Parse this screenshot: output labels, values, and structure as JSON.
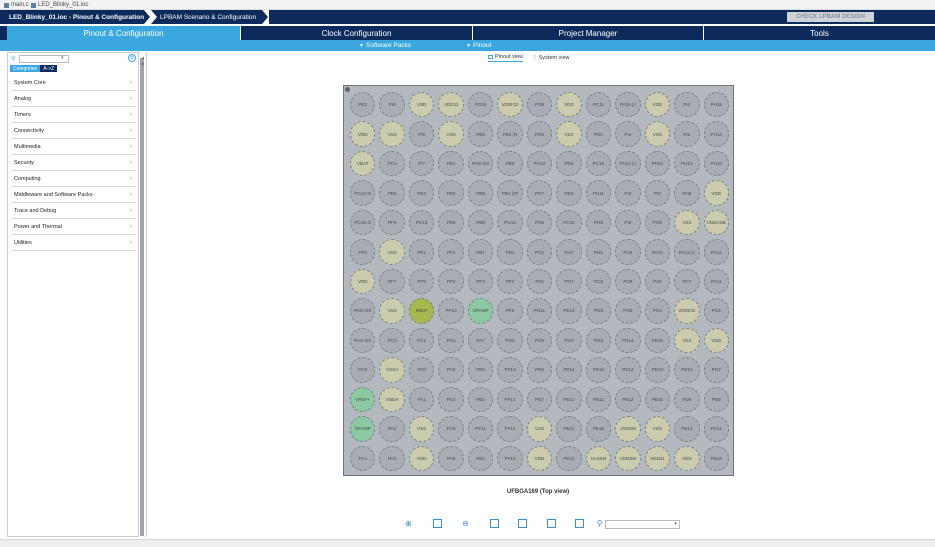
{
  "file_tabs": [
    "main.c",
    "LED_Blinky_01.ioc"
  ],
  "breadcrumbs": [
    "LED_Blinky_01.ioc - Pinout & Configuration",
    "LPBAM Scenario & Configuration"
  ],
  "check_button": "CHECK LPBAM DESIGN",
  "main_tabs": [
    "Pinout & Configuration",
    "Clock Configuration",
    "Project Manager",
    "Tools"
  ],
  "sub_menus": [
    "Software Packs",
    "Pinout"
  ],
  "left_panel": {
    "view_tabs": [
      "Categories",
      "A->Z"
    ],
    "categories": [
      "System Core",
      "Analog",
      "Timers",
      "Connectivity",
      "Multimedia",
      "Security",
      "Computing",
      "Middleware and Software Packs",
      "Trace and Debug",
      "Power and Thermal",
      "Utilities"
    ]
  },
  "view_toggles": [
    "Pinout view",
    "System view"
  ],
  "package": {
    "caption": "UFBGA169 (Top view)",
    "rows": [
      [
        "PE2",
        "PI6",
        "VDD",
        "VDD11",
        "PG15",
        "VDDIO2",
        "PG9",
        "VDD",
        "PC11",
        "PA15 (J",
        "VDD",
        "PI1",
        "PH15"
      ],
      [
        "VDD",
        "VSS",
        "PI5",
        "VSS",
        "PB6",
        "PB4 (N",
        "PD6",
        "VSS",
        "PD0",
        "PI4",
        "VSS",
        "PI2",
        "PH12"
      ],
      [
        "VBAT",
        "PC4",
        "PI7",
        "PE1",
        "PH9-SO",
        "PB5",
        "PG10",
        "PD4",
        "PC10",
        "PA14 (J",
        "PH14",
        "PH13",
        "PH10"
      ],
      [
        "PC14-O",
        "PE5",
        "PE3",
        "PE0",
        "PB8",
        "PB3 (JT",
        "PD7",
        "PD3",
        "PH11",
        "PI3",
        "PI2",
        "PH8",
        "VDD"
      ],
      [
        "PC15-O",
        "PF0",
        "PC13",
        "PE6",
        "PB9",
        "PG12",
        "PD5",
        "PC12",
        "PH8",
        "PI6",
        "PH6",
        "VSS",
        "VDDUSB"
      ],
      [
        "PF8",
        "VSS",
        "PF1",
        "PF2",
        "PB7",
        "PD1",
        "PD2",
        "PH7",
        "PH5",
        "PH3",
        "PA10",
        "PA13 (J",
        "PA12"
      ],
      [
        "VDD",
        "PF7",
        "PF9",
        "PF5",
        "PF3",
        "PF4",
        "PA8",
        "PG7",
        "PC8",
        "PC9",
        "PA9",
        "PC7",
        "PA11"
      ],
      [
        "PH0-OS",
        "VSS",
        "MB37",
        "PF10",
        "OPAMP",
        "PF6",
        "PD11",
        "PE13",
        "PG8",
        "PG6",
        "PG4",
        "VDDIO2",
        "PC6"
      ],
      [
        "PH1-OS",
        "PC0",
        "PC1",
        "PC2",
        "PA7",
        "PG0",
        "PE9",
        "PG3",
        "PG5",
        "PD14",
        "PD15",
        "VSS",
        "VDD"
      ],
      [
        "PC3",
        "VSSA",
        "PA0",
        "PA5",
        "PB0",
        "PF13",
        "PE8",
        "PE14",
        "PB10",
        "PD12",
        "PD13",
        "PD13",
        "PG2"
      ],
      [
        "VREF+",
        "VDDA",
        "PA1",
        "PC4",
        "PB2",
        "PF14",
        "PE7",
        "PE13",
        "PB11",
        "PB12",
        "PB15",
        "PD8",
        "PD9"
      ],
      [
        "OPAMP",
        "PA2",
        "VSS",
        "PC5",
        "PF11",
        "PF12",
        "VSS",
        "PE11",
        "PE15",
        "VSSSM",
        "VSS",
        "PB14",
        "PD11"
      ],
      [
        "PA4",
        "PA3",
        "VDD",
        "PA6",
        "PB1",
        "PF15",
        "VDD",
        "PE12",
        "VLXSM",
        "VDDSM",
        "VDD11",
        "VDD",
        "PB13"
      ]
    ],
    "power_pins": [
      "VDD",
      "VSS",
      "VDD11",
      "VDDIO2",
      "VBAT",
      "VSSA",
      "VDDA",
      "VSSSM",
      "VDDSM",
      "VLXSM",
      "VDDUSB"
    ],
    "green_pins": [
      "OPAMP",
      "VREF+"
    ],
    "assigned_pins": [
      "MB37"
    ],
    "colors": {
      "power": "#cbcbad",
      "green": "#8cc9a2",
      "assigned": "#a6b84e",
      "default": "#a8adb3"
    }
  },
  "toolbar_icons": [
    "zoom-in-icon",
    "fit-icon",
    "zoom-out-icon",
    "rotate-icon",
    "flip-icon",
    "export-icon",
    "layout-icon",
    "search-icon"
  ],
  "colors": {
    "navy": "#0d2a5c",
    "accent": "#3aa7e0"
  }
}
